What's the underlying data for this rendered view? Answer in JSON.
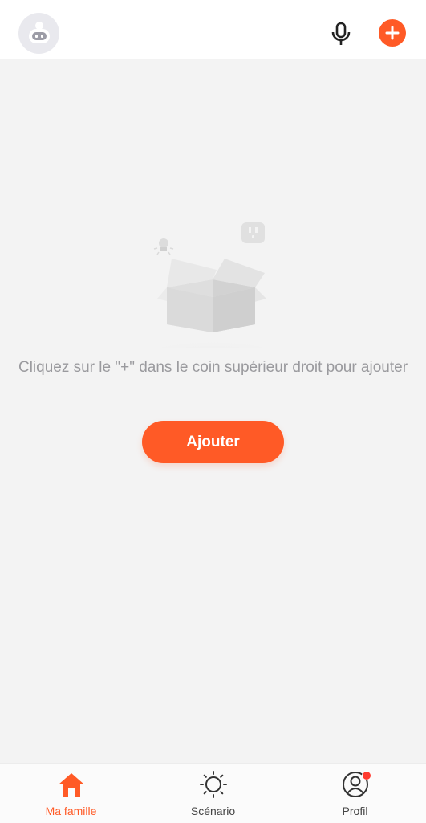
{
  "header": {
    "avatar_icon": "robot-avatar-icon",
    "mic_icon": "microphone-icon",
    "add_icon": "plus-icon"
  },
  "empty_state": {
    "illustration_icon": "empty-box-icon",
    "message": "Cliquez sur le \"+\" dans le coin supérieur droit pour ajouter",
    "button_label": "Ajouter"
  },
  "tabs": [
    {
      "label": "Ma famille",
      "icon": "home-icon",
      "active": true
    },
    {
      "label": "Scénario",
      "icon": "sun-icon",
      "active": false
    },
    {
      "label": "Profil",
      "icon": "profile-icon",
      "active": false,
      "badge": true
    }
  ],
  "colors": {
    "accent": "#ff5a26",
    "background": "#f3f3f3",
    "badge": "#ff3b30"
  }
}
